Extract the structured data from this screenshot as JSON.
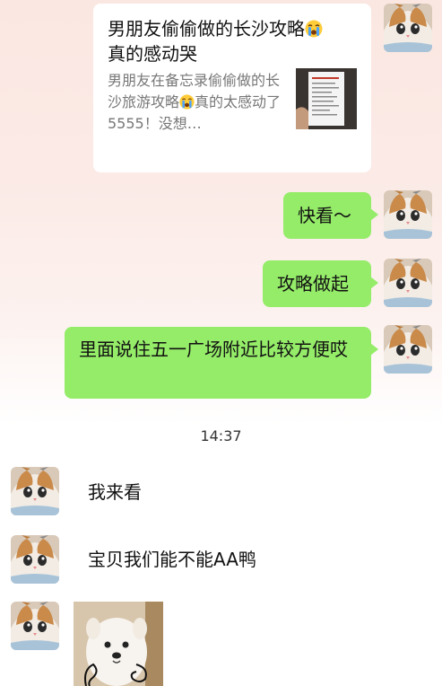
{
  "share_card": {
    "title": "男朋友偷偷做的长沙攻略",
    "title_line2": "真的感动哭",
    "desc_part1": "男朋友在备忘录偷偷做的长沙旅游攻略",
    "desc_part2": "真的太感动了5555！没想…",
    "emoji": "loudly-crying-face"
  },
  "messages_sent": [
    {
      "text": "快看～"
    },
    {
      "text": "攻略做起"
    },
    {
      "text": "里面说住五一广场附近比较方便哎"
    }
  ],
  "timestamp": "14:37",
  "messages_received": [
    {
      "text": "我来看"
    },
    {
      "text": "宝贝我们能不能AA鸭"
    }
  ],
  "colors": {
    "sent_bubble": "#95ec69",
    "received_bubble": "#ffffff"
  }
}
